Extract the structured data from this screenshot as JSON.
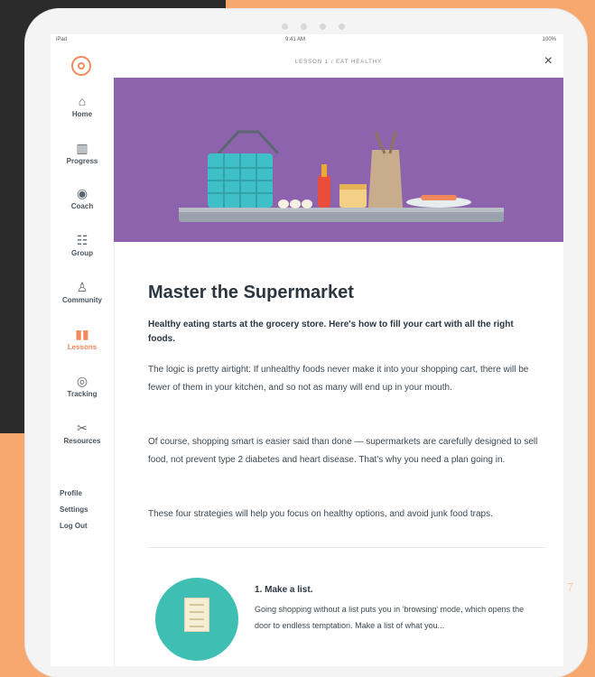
{
  "status_bar": {
    "left": "iPad",
    "center": "9:41 AM",
    "right": "100%"
  },
  "sidebar": {
    "items": [
      {
        "label": "Home",
        "icon": "home-icon"
      },
      {
        "label": "Progress",
        "icon": "bar-chart-icon"
      },
      {
        "label": "Coach",
        "icon": "coach-icon"
      },
      {
        "label": "Group",
        "icon": "group-icon"
      },
      {
        "label": "Community",
        "icon": "community-icon"
      },
      {
        "label": "Lessons",
        "icon": "book-icon",
        "active": true
      },
      {
        "label": "Tracking",
        "icon": "check-circle-icon"
      },
      {
        "label": "Resources",
        "icon": "resources-icon"
      }
    ],
    "sub_links": [
      "Profile",
      "Settings",
      "Log Out"
    ]
  },
  "topbar": {
    "breadcrumb": "LESSON 1 / EAT HEALTHY",
    "close_label": "×"
  },
  "article": {
    "title": "Master the Supermarket",
    "lead": "Healthy eating starts at the grocery store. Here's how to fill your cart with all the right foods.",
    "paragraphs": [
      "The logic is pretty airtight: If unhealthy foods never make it into your shopping cart, there will be fewer of them in your kitchen, and so not as many will end up in your mouth.",
      "Of course, shopping smart is easier said than done — supermarkets are carefully designed to sell food, not prevent type 2 diabetes and heart disease. That's why you need a plan going in.",
      "These four strategies will help you focus on healthy options, and avoid junk food traps."
    ],
    "tip": {
      "title": "1. Make a list.",
      "body": "Going shopping without a list puts you in 'browsing' mode, which opens the door to endless temptation. Make a list of what you..."
    }
  },
  "page_marker": "7",
  "colors": {
    "accent": "#f08a5d",
    "hero": "#8e63ae",
    "tip_circle": "#3fbfb4",
    "background": "#f7a86e"
  }
}
